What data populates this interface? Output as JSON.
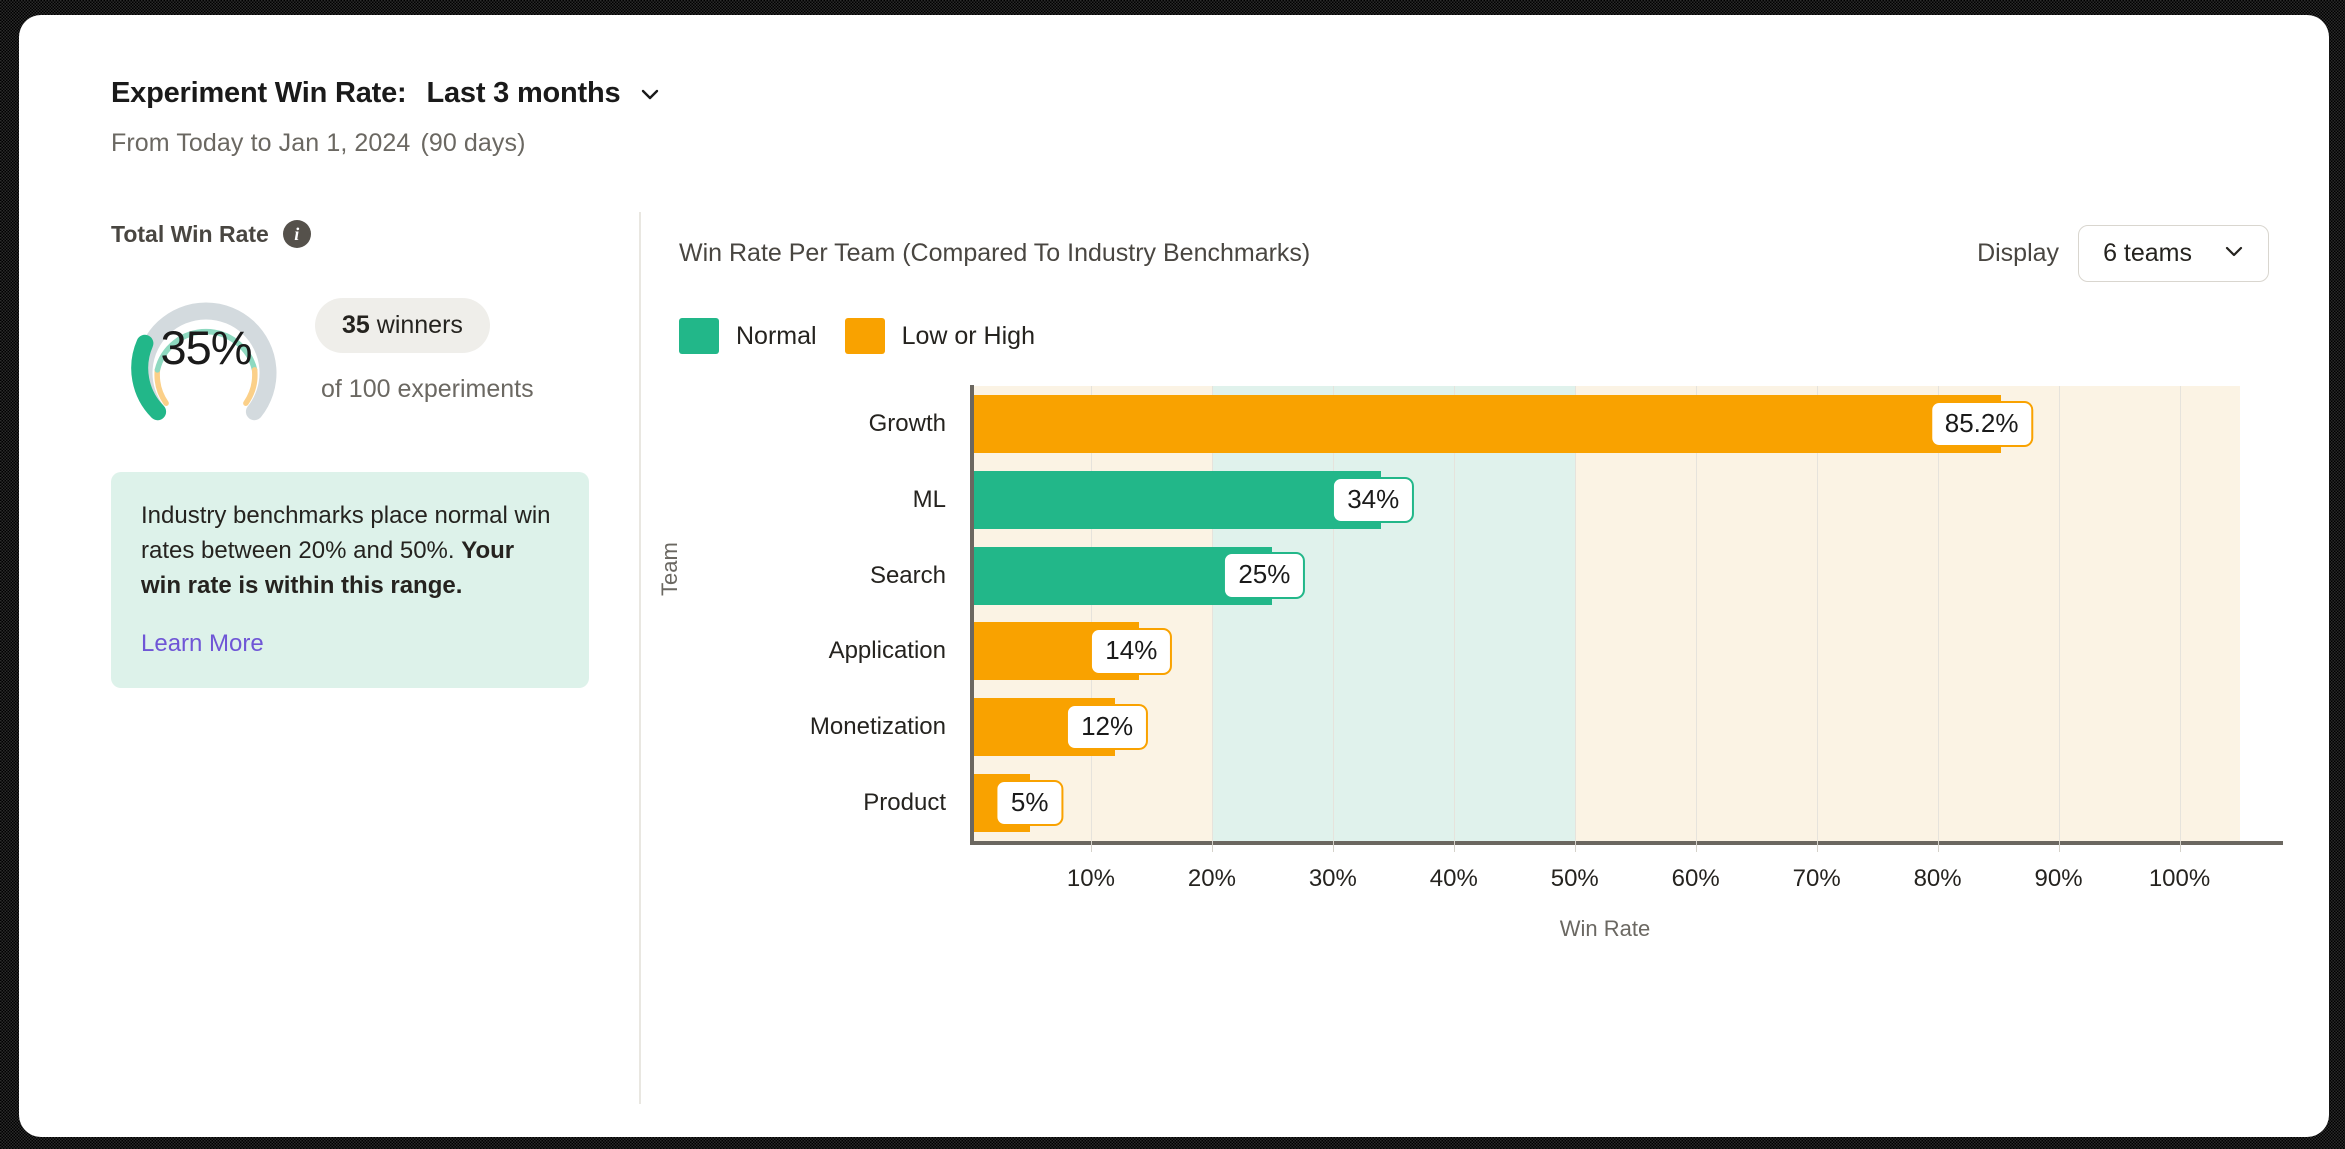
{
  "header": {
    "title_lead": "Experiment Win Rate:",
    "range_value": "Last 3 months",
    "range_chevron_icon": "chevron-down-icon",
    "subtitle_main": "From Today to Jan 1, 2024",
    "subtitle_days": "(90 days)"
  },
  "left": {
    "panel_label": "Total Win Rate",
    "info_icon": "info-icon",
    "info_glyph": "i",
    "gauge": {
      "value_label": "35%",
      "value": 35,
      "max": 100,
      "track_color": "#d3dade",
      "fill_color": "#22b789",
      "benchmark_low": 20,
      "benchmark_high": 50,
      "benchmark_normal_color": "#8ed9c0",
      "benchmark_outside_color": "#fbd089"
    },
    "winners_count": "35",
    "winners_word": "winners",
    "winners_sub": "of 100 experiments",
    "callout_text_1": "Industry benchmarks place normal win rates between 20% and 50%. ",
    "callout_text_bold": "Your win rate is within this range.",
    "callout_link": "Learn More",
    "callout_bg": "#ddf2ea",
    "link_color": "#6f56d6"
  },
  "right": {
    "chart_title": "Win Rate Per Team (Compared To Industry Benchmarks)",
    "display_label": "Display",
    "display_value": "6 teams",
    "display_chevron_icon": "chevron-down-icon",
    "legend": [
      {
        "label": "Normal",
        "color": "#22b789"
      },
      {
        "label": "Low or High",
        "color": "#f9a200"
      }
    ]
  },
  "chart_data": {
    "type": "bar",
    "orientation": "horizontal",
    "title": "Win Rate Per Team (Compared To Industry Benchmarks)",
    "xlabel": "Win Rate",
    "ylabel": "Team",
    "xlim": [
      0,
      105
    ],
    "xticks": [
      10,
      20,
      30,
      40,
      50,
      60,
      70,
      80,
      90,
      100
    ],
    "xtick_labels": [
      "10%",
      "20%",
      "30%",
      "40%",
      "50%",
      "60%",
      "70%",
      "80%",
      "90%",
      "100%"
    ],
    "grid": true,
    "legend_position": "top-left",
    "categories": [
      "Growth",
      "ML",
      "Search",
      "Application",
      "Monetization",
      "Product"
    ],
    "values": [
      85.2,
      34,
      25,
      14,
      12,
      5
    ],
    "value_labels": [
      "85.2%",
      "34%",
      "25%",
      "14%",
      "12%",
      "5%"
    ],
    "bar_colors": [
      "#f9a200",
      "#22b789",
      "#22b789",
      "#f9a200",
      "#f9a200",
      "#f9a200"
    ],
    "bar_states": [
      "Low or High",
      "Normal",
      "Normal",
      "Low or High",
      "Low or High",
      "Low or High"
    ],
    "benchmark_bands": [
      {
        "from": 0,
        "to": 20,
        "color": "#fbf3e4",
        "label": "Low"
      },
      {
        "from": 20,
        "to": 50,
        "color": "#e0f2ec",
        "label": "Normal"
      },
      {
        "from": 50,
        "to": 105,
        "color": "#fbf3e4",
        "label": "High"
      }
    ]
  }
}
